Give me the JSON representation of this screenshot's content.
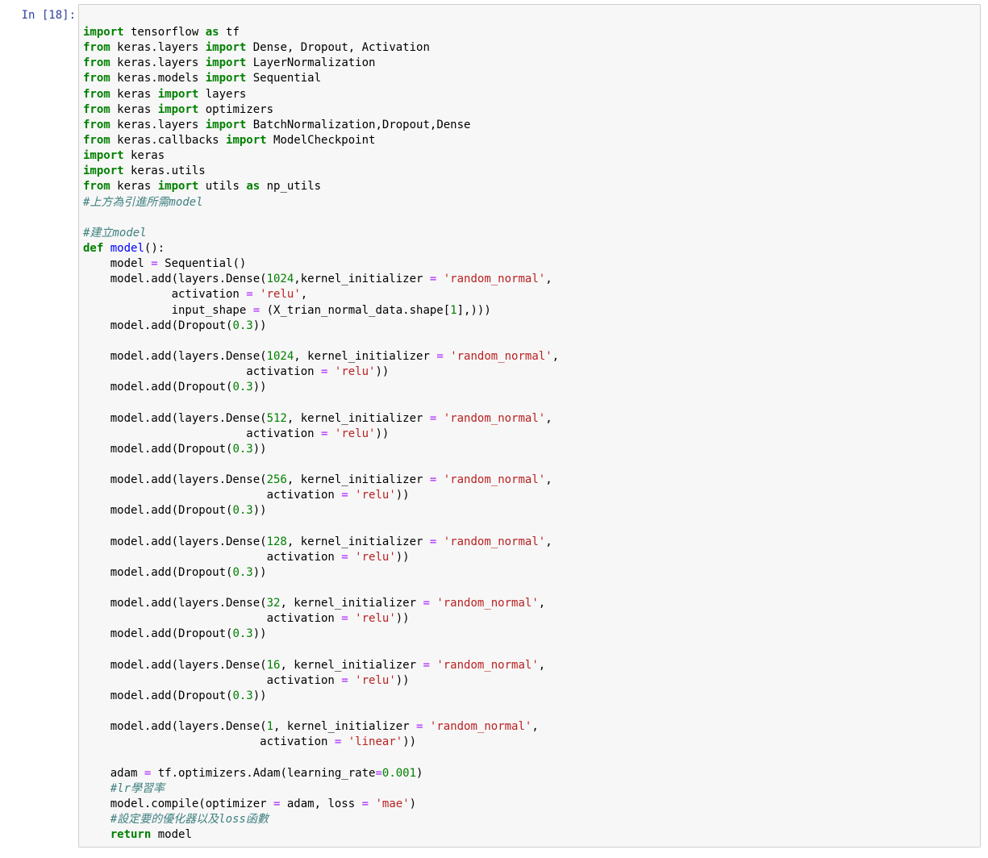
{
  "cell": {
    "prompt": "In [18]:",
    "execution_count": 18
  },
  "colors": {
    "keyword": "#008000",
    "operator": "#aa22ff",
    "string": "#ba2121",
    "number": "#008000",
    "comment": "#408080",
    "function_name": "#0000ff",
    "prompt": "#303f9f",
    "cell_background": "#f7f7f7",
    "cell_border": "#cfcfcf"
  },
  "code_lines": [
    [
      [
        "kw",
        "import"
      ],
      [
        "t",
        " tensorflow "
      ],
      [
        "kw",
        "as"
      ],
      [
        "t",
        " tf"
      ]
    ],
    [
      [
        "kw",
        "from"
      ],
      [
        "t",
        " keras.layers "
      ],
      [
        "kw",
        "import"
      ],
      [
        "t",
        " Dense, Dropout, Activation"
      ]
    ],
    [
      [
        "kw",
        "from"
      ],
      [
        "t",
        " keras.layers "
      ],
      [
        "kw",
        "import"
      ],
      [
        "t",
        " LayerNormalization"
      ]
    ],
    [
      [
        "kw",
        "from"
      ],
      [
        "t",
        " keras.models "
      ],
      [
        "kw",
        "import"
      ],
      [
        "t",
        " Sequential"
      ]
    ],
    [
      [
        "kw",
        "from"
      ],
      [
        "t",
        " keras "
      ],
      [
        "kw",
        "import"
      ],
      [
        "t",
        " layers"
      ]
    ],
    [
      [
        "kw",
        "from"
      ],
      [
        "t",
        " keras "
      ],
      [
        "kw",
        "import"
      ],
      [
        "t",
        " optimizers"
      ]
    ],
    [
      [
        "kw",
        "from"
      ],
      [
        "t",
        " keras.layers "
      ],
      [
        "kw",
        "import"
      ],
      [
        "t",
        " BatchNormalization,Dropout,Dense"
      ]
    ],
    [
      [
        "kw",
        "from"
      ],
      [
        "t",
        " keras.callbacks "
      ],
      [
        "kw",
        "import"
      ],
      [
        "t",
        " ModelCheckpoint"
      ]
    ],
    [
      [
        "kw",
        "import"
      ],
      [
        "t",
        " keras"
      ]
    ],
    [
      [
        "kw",
        "import"
      ],
      [
        "t",
        " keras.utils"
      ]
    ],
    [
      [
        "kw",
        "from"
      ],
      [
        "t",
        " keras "
      ],
      [
        "kw",
        "import"
      ],
      [
        "t",
        " utils "
      ],
      [
        "kw",
        "as"
      ],
      [
        "t",
        " np_utils"
      ]
    ],
    [
      [
        "cm",
        "#上方為引進所需model"
      ]
    ],
    [],
    [
      [
        "cm",
        "#建立model"
      ]
    ],
    [
      [
        "kw",
        "def"
      ],
      [
        "t",
        " "
      ],
      [
        "fn",
        "model"
      ],
      [
        "t",
        "():"
      ]
    ],
    [
      [
        "t",
        "    model "
      ],
      [
        "op",
        "="
      ],
      [
        "t",
        " Sequential()"
      ]
    ],
    [
      [
        "t",
        "    model.add(layers.Dense("
      ],
      [
        "num",
        "1024"
      ],
      [
        "t",
        ",kernel_initializer "
      ],
      [
        "op",
        "="
      ],
      [
        "t",
        " "
      ],
      [
        "str",
        "'random_normal'"
      ],
      [
        "t",
        ","
      ]
    ],
    [
      [
        "t",
        "             activation "
      ],
      [
        "op",
        "="
      ],
      [
        "t",
        " "
      ],
      [
        "str",
        "'relu'"
      ],
      [
        "t",
        ","
      ]
    ],
    [
      [
        "t",
        "             input_shape "
      ],
      [
        "op",
        "="
      ],
      [
        "t",
        " (X_trian_normal_data.shape["
      ],
      [
        "num",
        "1"
      ],
      [
        "t",
        "],)))"
      ]
    ],
    [
      [
        "t",
        "    model.add(Dropout("
      ],
      [
        "num",
        "0.3"
      ],
      [
        "t",
        "))"
      ]
    ],
    [],
    [
      [
        "t",
        "    model.add(layers.Dense("
      ],
      [
        "num",
        "1024"
      ],
      [
        "t",
        ", kernel_initializer "
      ],
      [
        "op",
        "="
      ],
      [
        "t",
        " "
      ],
      [
        "str",
        "'random_normal'"
      ],
      [
        "t",
        ","
      ]
    ],
    [
      [
        "t",
        "                        activation "
      ],
      [
        "op",
        "="
      ],
      [
        "t",
        " "
      ],
      [
        "str",
        "'relu'"
      ],
      [
        "t",
        "))"
      ]
    ],
    [
      [
        "t",
        "    model.add(Dropout("
      ],
      [
        "num",
        "0.3"
      ],
      [
        "t",
        "))"
      ]
    ],
    [],
    [
      [
        "t",
        "    model.add(layers.Dense("
      ],
      [
        "num",
        "512"
      ],
      [
        "t",
        ", kernel_initializer "
      ],
      [
        "op",
        "="
      ],
      [
        "t",
        " "
      ],
      [
        "str",
        "'random_normal'"
      ],
      [
        "t",
        ","
      ]
    ],
    [
      [
        "t",
        "                        activation "
      ],
      [
        "op",
        "="
      ],
      [
        "t",
        " "
      ],
      [
        "str",
        "'relu'"
      ],
      [
        "t",
        "))"
      ]
    ],
    [
      [
        "t",
        "    model.add(Dropout("
      ],
      [
        "num",
        "0.3"
      ],
      [
        "t",
        "))"
      ]
    ],
    [],
    [
      [
        "t",
        "    model.add(layers.Dense("
      ],
      [
        "num",
        "256"
      ],
      [
        "t",
        ", kernel_initializer "
      ],
      [
        "op",
        "="
      ],
      [
        "t",
        " "
      ],
      [
        "str",
        "'random_normal'"
      ],
      [
        "t",
        ","
      ]
    ],
    [
      [
        "t",
        "                           activation "
      ],
      [
        "op",
        "="
      ],
      [
        "t",
        " "
      ],
      [
        "str",
        "'relu'"
      ],
      [
        "t",
        "))"
      ]
    ],
    [
      [
        "t",
        "    model.add(Dropout("
      ],
      [
        "num",
        "0.3"
      ],
      [
        "t",
        "))"
      ]
    ],
    [],
    [
      [
        "t",
        "    model.add(layers.Dense("
      ],
      [
        "num",
        "128"
      ],
      [
        "t",
        ", kernel_initializer "
      ],
      [
        "op",
        "="
      ],
      [
        "t",
        " "
      ],
      [
        "str",
        "'random_normal'"
      ],
      [
        "t",
        ","
      ]
    ],
    [
      [
        "t",
        "                           activation "
      ],
      [
        "op",
        "="
      ],
      [
        "t",
        " "
      ],
      [
        "str",
        "'relu'"
      ],
      [
        "t",
        "))"
      ]
    ],
    [
      [
        "t",
        "    model.add(Dropout("
      ],
      [
        "num",
        "0.3"
      ],
      [
        "t",
        "))"
      ]
    ],
    [],
    [
      [
        "t",
        "    model.add(layers.Dense("
      ],
      [
        "num",
        "32"
      ],
      [
        "t",
        ", kernel_initializer "
      ],
      [
        "op",
        "="
      ],
      [
        "t",
        " "
      ],
      [
        "str",
        "'random_normal'"
      ],
      [
        "t",
        ","
      ]
    ],
    [
      [
        "t",
        "                           activation "
      ],
      [
        "op",
        "="
      ],
      [
        "t",
        " "
      ],
      [
        "str",
        "'relu'"
      ],
      [
        "t",
        "))"
      ]
    ],
    [
      [
        "t",
        "    model.add(Dropout("
      ],
      [
        "num",
        "0.3"
      ],
      [
        "t",
        "))"
      ]
    ],
    [],
    [
      [
        "t",
        "    model.add(layers.Dense("
      ],
      [
        "num",
        "16"
      ],
      [
        "t",
        ", kernel_initializer "
      ],
      [
        "op",
        "="
      ],
      [
        "t",
        " "
      ],
      [
        "str",
        "'random_normal'"
      ],
      [
        "t",
        ","
      ]
    ],
    [
      [
        "t",
        "                           activation "
      ],
      [
        "op",
        "="
      ],
      [
        "t",
        " "
      ],
      [
        "str",
        "'relu'"
      ],
      [
        "t",
        "))"
      ]
    ],
    [
      [
        "t",
        "    model.add(Dropout("
      ],
      [
        "num",
        "0.3"
      ],
      [
        "t",
        "))"
      ]
    ],
    [],
    [
      [
        "t",
        "    model.add(layers.Dense("
      ],
      [
        "num",
        "1"
      ],
      [
        "t",
        ", kernel_initializer "
      ],
      [
        "op",
        "="
      ],
      [
        "t",
        " "
      ],
      [
        "str",
        "'random_normal'"
      ],
      [
        "t",
        ","
      ]
    ],
    [
      [
        "t",
        "                          activation "
      ],
      [
        "op",
        "="
      ],
      [
        "t",
        " "
      ],
      [
        "str",
        "'linear'"
      ],
      [
        "t",
        "))"
      ]
    ],
    [],
    [
      [
        "t",
        "    adam "
      ],
      [
        "op",
        "="
      ],
      [
        "t",
        " tf.optimizers.Adam(learning_rate"
      ],
      [
        "op",
        "="
      ],
      [
        "num",
        "0.001"
      ],
      [
        "t",
        ")"
      ]
    ],
    [
      [
        "t",
        "    "
      ],
      [
        "cm",
        "#lr學習率"
      ]
    ],
    [
      [
        "t",
        "    model.compile(optimizer "
      ],
      [
        "op",
        "="
      ],
      [
        "t",
        " adam, loss "
      ],
      [
        "op",
        "="
      ],
      [
        "t",
        " "
      ],
      [
        "str",
        "'mae'"
      ],
      [
        "t",
        ")"
      ]
    ],
    [
      [
        "t",
        "    "
      ],
      [
        "cm",
        "#設定要的優化器以及loss函數"
      ]
    ],
    [
      [
        "t",
        "    "
      ],
      [
        "kw",
        "return"
      ],
      [
        "t",
        " model"
      ]
    ]
  ]
}
